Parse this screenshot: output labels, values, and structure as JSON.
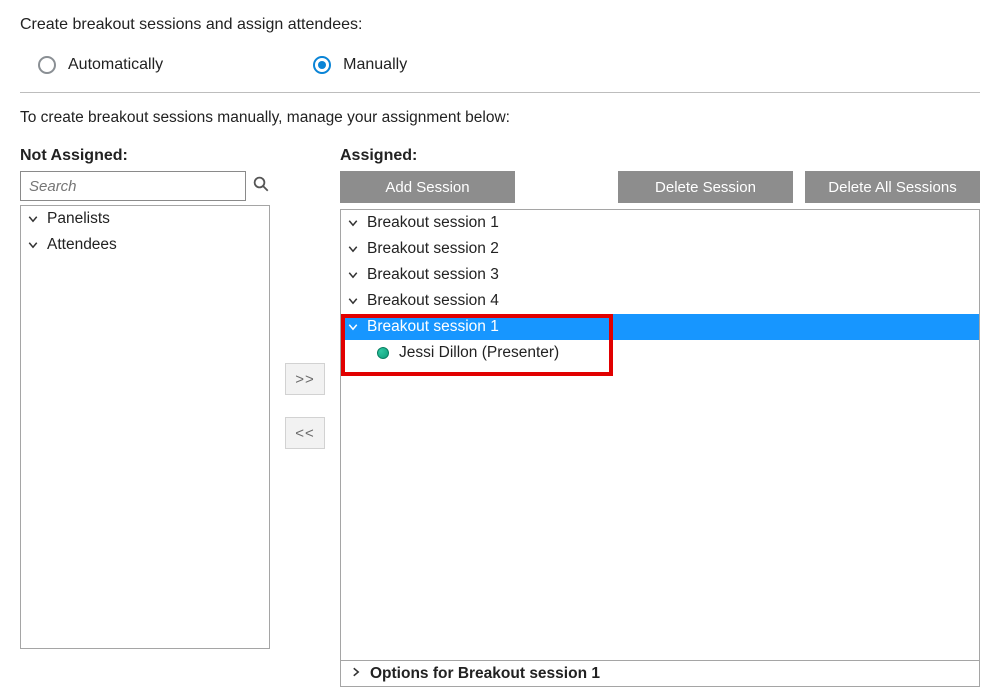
{
  "header": "Create breakout sessions and assign attendees:",
  "radio": {
    "auto_label": "Automatically",
    "manual_label": "Manually",
    "selected": "manual"
  },
  "instruction": "To create breakout sessions manually, manage your assignment below:",
  "left": {
    "title": "Not Assigned:",
    "search_placeholder": "Search",
    "groups": [
      "Panelists",
      "Attendees"
    ]
  },
  "mid": {
    "move_in": ">>",
    "move_out": "<<"
  },
  "right": {
    "title": "Assigned:",
    "buttons": {
      "add": "Add Session",
      "delete": "Delete Session",
      "delete_all": "Delete All Sessions"
    },
    "sessions": [
      {
        "name": "Breakout session 1",
        "selected": false,
        "attendees": []
      },
      {
        "name": "Breakout session 2",
        "selected": false,
        "attendees": []
      },
      {
        "name": "Breakout session 3",
        "selected": false,
        "attendees": []
      },
      {
        "name": "Breakout session 4",
        "selected": false,
        "attendees": []
      },
      {
        "name": "Breakout session 1",
        "selected": true,
        "attendees": [
          "Jessi Dillon (Presenter)"
        ]
      }
    ],
    "options_label": "Options for Breakout session 1"
  }
}
